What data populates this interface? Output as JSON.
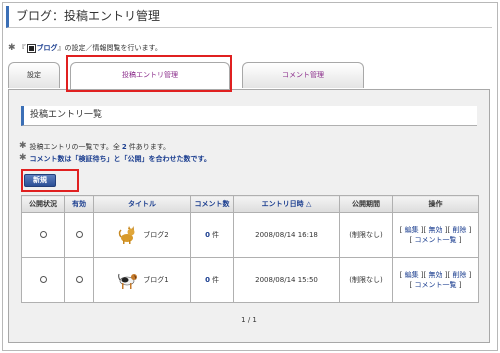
{
  "page_title": "ブログ：投稿エントリ管理",
  "description": {
    "prefix": "『",
    "blog_name": "ブログ",
    "suffix": "』の設定／情報閲覧を行います。"
  },
  "tabs": [
    {
      "label": "設定"
    },
    {
      "label": "投稿エントリ管理"
    },
    {
      "label": "コメント管理"
    }
  ],
  "panel_title": "投稿エントリ一覧",
  "notes": {
    "count_prefix": "投稿エントリの一覧です。全",
    "count": "2",
    "count_suffix": "件あります。",
    "comment_note": "コメント数は「検証待ち」と「公開」を合わせた数です。"
  },
  "new_button": "新規",
  "table": {
    "headers": {
      "status": "公開状況",
      "enabled": "有効",
      "title": "タイトル",
      "comments": "コメント数",
      "datetime": "エントリ日時 △",
      "period": "公開期間",
      "ops": "操作"
    },
    "rows": [
      {
        "title": "ブログ2",
        "comment_count": "0",
        "comment_unit": "件",
        "datetime": "2008/08/14 16:18",
        "period": "(制限なし)",
        "op_edit": "編集",
        "op_disable": "無効",
        "op_delete": "削除",
        "op_comment": "コメント一覧"
      },
      {
        "title": "ブログ1",
        "comment_count": "0",
        "comment_unit": "件",
        "datetime": "2008/08/14 15:50",
        "period": "(制限なし)",
        "op_edit": "編集",
        "op_disable": "無効",
        "op_delete": "削除",
        "op_comment": "コメント一覧"
      }
    ]
  },
  "pager": "1 / 1",
  "colors": {
    "accent": "#3b6fb6",
    "link": "#1a3d8f",
    "highlight": "#e02020",
    "tab_text": "#8a2b8a"
  },
  "icons": {
    "bullet": "gear-icon",
    "blog_logo": "blog-logo-icon",
    "thumbnail_1": "cat-icon",
    "thumbnail_2": "dog-icon"
  }
}
